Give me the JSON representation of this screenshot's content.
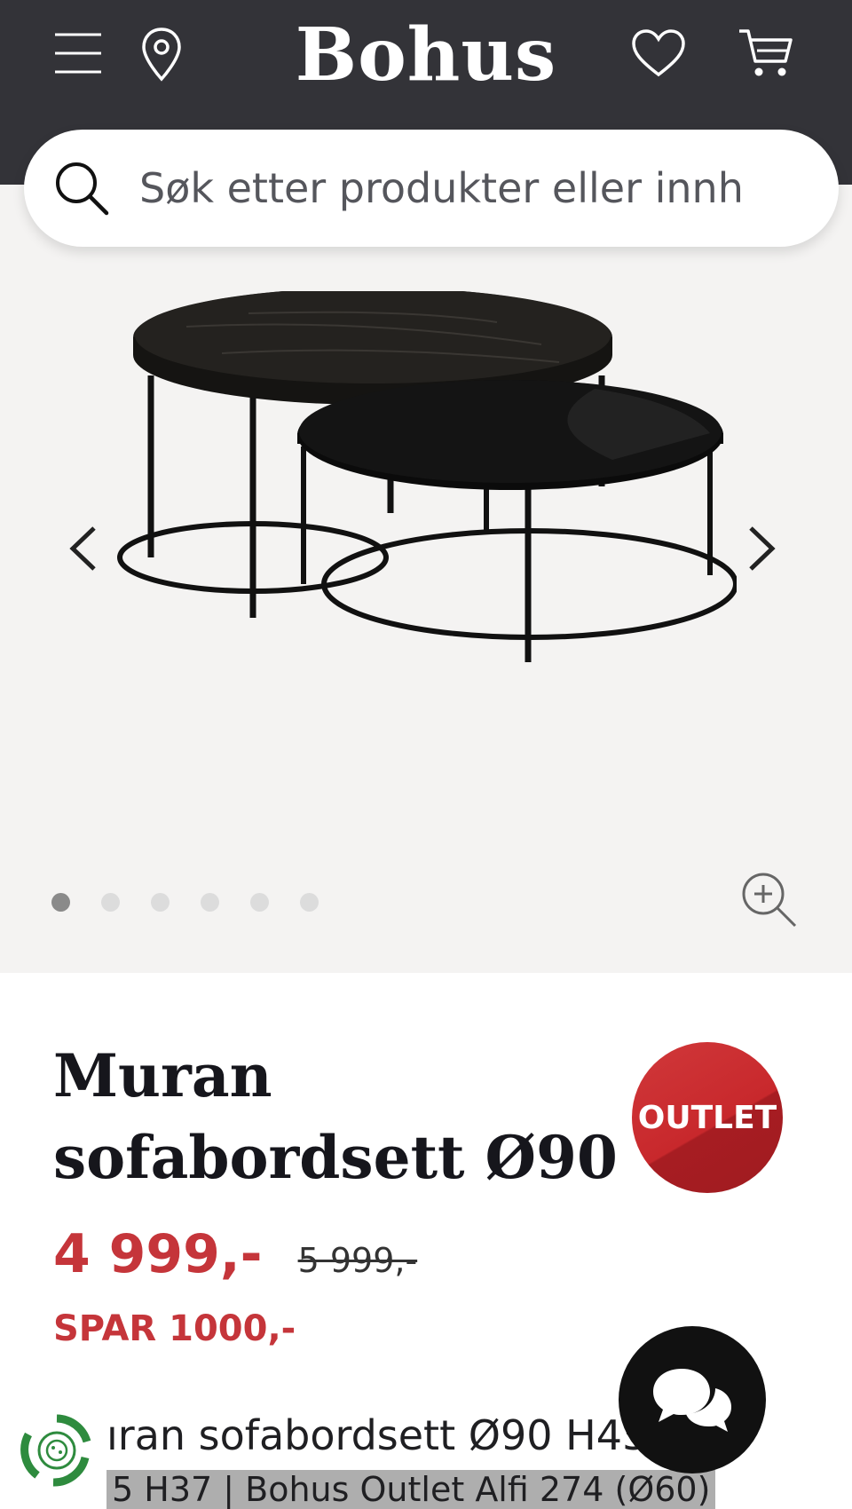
{
  "header": {
    "logo": "Bohus",
    "icons": {
      "menu": "hamburger-icon",
      "location": "map-pin-icon",
      "wishlist": "heart-icon",
      "cart": "cart-icon"
    }
  },
  "search": {
    "placeholder": "Søk etter produkter eller innh",
    "icon": "search-icon"
  },
  "gallery": {
    "image_alt": "Muran sofabordsett Ø90",
    "slide_count": 6,
    "active_slide": 1,
    "icons": {
      "prev": "chevron-left-icon",
      "next": "chevron-right-icon",
      "zoom": "zoom-in-icon"
    }
  },
  "product": {
    "title": "Muran sofabordsett Ø90",
    "badge": "OUTLET",
    "price": "4 999,-",
    "old_price": "5 999,-",
    "savings": "SPAR 1000,-",
    "description_line1": "ıran sofabordsett Ø90 H45.",
    "description_line2": "5 H37 | Bohus Outlet Alfi 274 (Ø60)"
  },
  "colors": {
    "header_bg": "#333338",
    "price_red": "#c5353a",
    "badge_red": "#c8282c",
    "gallery_bg": "#f4f3f2"
  },
  "chat": {
    "icon": "chat-bubbles-icon"
  },
  "eco_badge": {
    "icon": "recycle-icon"
  }
}
